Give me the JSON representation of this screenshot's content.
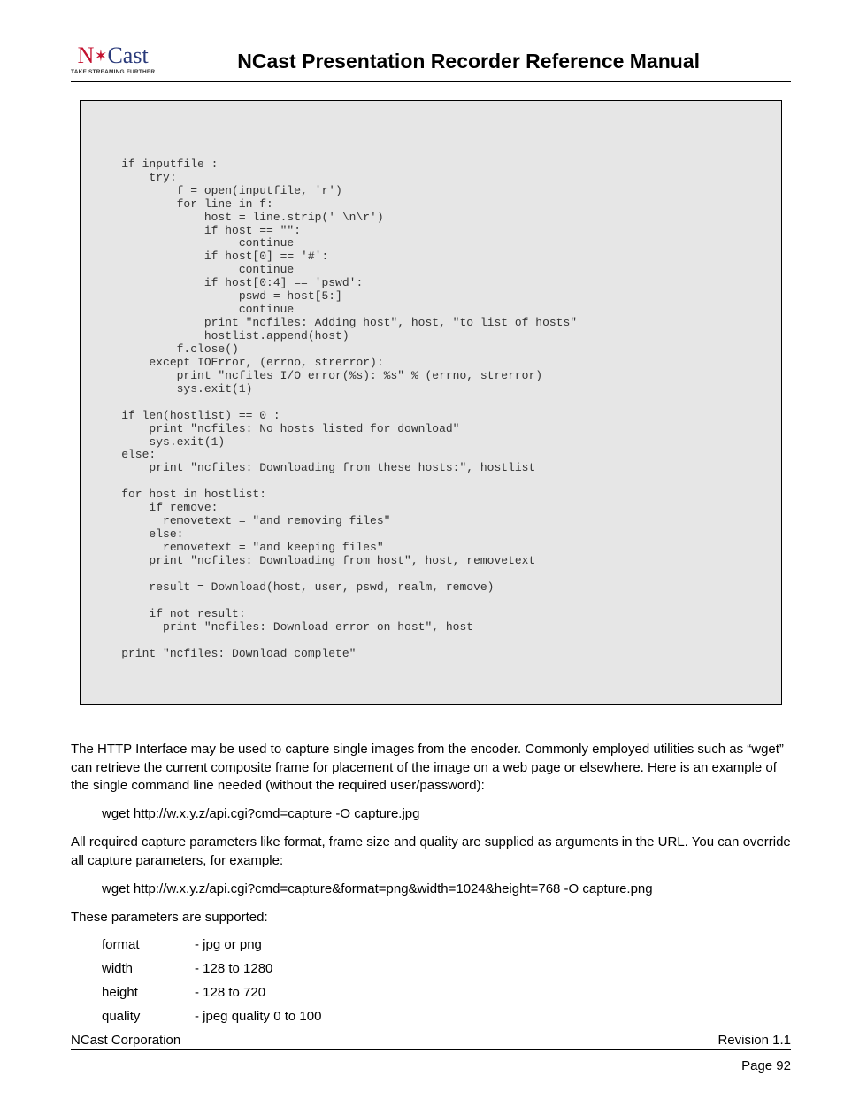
{
  "logo": {
    "main_n": "N",
    "main_cast": "Cast",
    "tagline": "TAKE STREAMING FURTHER"
  },
  "doc_title": "NCast Presentation Recorder Reference Manual",
  "code": "\n\n\n    if inputfile :\n        try:\n            f = open(inputfile, 'r')\n            for line in f:\n                host = line.strip(' \\n\\r')\n                if host == \"\":\n                     continue\n                if host[0] == '#':\n                     continue\n                if host[0:4] == 'pswd':\n                     pswd = host[5:]\n                     continue\n                print \"ncfiles: Adding host\", host, \"to list of hosts\"\n                hostlist.append(host)\n            f.close()\n        except IOError, (errno, strerror):\n            print \"ncfiles I/O error(%s): %s\" % (errno, strerror)\n            sys.exit(1)\n\n    if len(hostlist) == 0 :\n        print \"ncfiles: No hosts listed for download\"\n        sys.exit(1)\n    else:\n        print \"ncfiles: Downloading from these hosts:\", hostlist\n\n    for host in hostlist:\n        if remove:\n          removetext = \"and removing files\"\n        else:\n          removetext = \"and keeping files\"\n        print \"ncfiles: Downloading from host\", host, removetext\n\n        result = Download(host, user, pswd, realm, remove)\n\n        if not result:\n          print \"ncfiles: Download error on host\", host\n\n    print \"ncfiles: Download complete\"",
  "para1": "The HTTP Interface may be used to capture single images from the encoder. Commonly employed utilities such as “wget” can retrieve the current composite frame for placement of the image on a web page or elsewhere. Here is an example of the single command line needed (without the required user/password):",
  "cmd1": "wget http://w.x.y.z/api.cgi?cmd=capture -O capture.jpg",
  "para2": "All required capture parameters like format, frame size and quality are supplied as arguments in the URL. You can override all capture parameters, for example:",
  "cmd2": "wget http://w.x.y.z/api.cgi?cmd=capture&format=png&width=1024&height=768 -O capture.png",
  "para3": "These parameters are supported:",
  "params": [
    {
      "name": "format",
      "desc": "- jpg or png"
    },
    {
      "name": "width",
      "desc": "- 128 to 1280"
    },
    {
      "name": "height",
      "desc": "- 128 to 720"
    },
    {
      "name": "quality",
      "desc": "- jpeg quality 0 to 100"
    }
  ],
  "footer": {
    "left": "NCast Corporation",
    "right": "Revision 1.1",
    "page": "Page 92"
  }
}
